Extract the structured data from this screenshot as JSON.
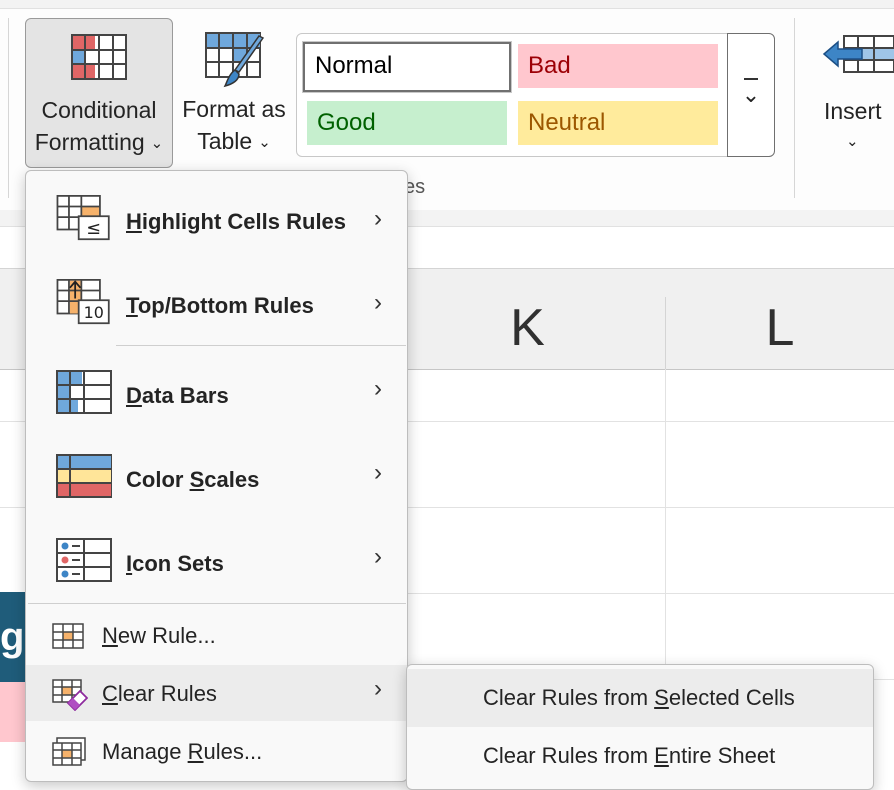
{
  "ribbon": {
    "conditional_formatting": {
      "line1": "Conditional",
      "line2": "Formatting",
      "chevron": "⌄"
    },
    "format_as_table": {
      "line1": "Format as",
      "line2": "Table",
      "chevron": "⌄"
    },
    "cell_styles": {
      "normal": "Normal",
      "bad": "Bad",
      "good": "Good",
      "neutral": "Neutral",
      "more_glyph": "⌄",
      "group_label_fragment": "es"
    },
    "insert": {
      "label": "Insert",
      "chevron": "⌄"
    }
  },
  "sheet": {
    "columns": [
      "K",
      "L"
    ],
    "left_cell_fragment": "g"
  },
  "menu": {
    "items": [
      {
        "label": "Highlight Cells Rules",
        "mnemonic": "H",
        "rest": "ighlight Cells Rules",
        "icon": "highlight-cells-rules-icon",
        "icon_badge": "≤",
        "has_submenu": true
      },
      {
        "label": "Top/Bottom Rules",
        "mnemonic": "T",
        "rest": "op/Bottom Rules",
        "icon": "top-bottom-rules-icon",
        "icon_badge": "10",
        "has_submenu": true
      },
      {
        "label": "Data Bars",
        "mnemonic": "D",
        "rest": "ata Bars",
        "icon": "data-bars-icon",
        "has_submenu": true
      },
      {
        "label": "Color Scales",
        "pre": "Color ",
        "mnemonic": "S",
        "rest": "cales",
        "icon": "color-scales-icon",
        "has_submenu": true
      },
      {
        "label": "Icon Sets",
        "mnemonic": "I",
        "rest": "con Sets",
        "icon": "icon-sets-icon",
        "has_submenu": true
      },
      {
        "label": "New Rule...",
        "mnemonic": "N",
        "rest": "ew Rule...",
        "icon": "new-rule-icon",
        "has_submenu": false
      },
      {
        "label": "Clear Rules",
        "mnemonic": "C",
        "rest": "lear Rules",
        "icon": "clear-rules-icon",
        "has_submenu": true,
        "highlighted": true
      },
      {
        "label": "Manage Rules...",
        "pre": "Manage ",
        "mnemonic": "R",
        "rest": "ules...",
        "icon": "manage-rules-icon",
        "has_submenu": false
      }
    ],
    "arrow_glyph": "›"
  },
  "submenu": {
    "items": [
      {
        "pre": "Clear Rules from ",
        "mnemonic": "S",
        "rest": "elected Cells",
        "highlighted": true
      },
      {
        "pre": "Clear Rules from ",
        "mnemonic": "E",
        "rest": "ntire Sheet",
        "highlighted": false
      }
    ]
  },
  "colors": {
    "bad_fill": "#ffc7ce",
    "bad_text": "#9c0006",
    "good_fill": "#c6efce",
    "good_text": "#006100",
    "neutral_fill": "#ffeb9c",
    "neutral_text": "#9c5700",
    "icon_blue": "#6fa8dc",
    "icon_red": "#e06666",
    "icon_orange": "#f6b26b"
  }
}
